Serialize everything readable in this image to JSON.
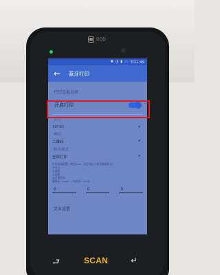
{
  "device": {
    "brand_logo_text": "DDD",
    "bottom_buttons": {
      "back_glyph": "⮐",
      "scan_label": "SCAN",
      "enter_glyph": "↵"
    }
  },
  "status": {
    "time": "下午1:49"
  },
  "app": {
    "title": "蓝牙打印",
    "back_icon": "arrow-left-icon"
  },
  "settings": {
    "printer_section": "打印设备选择",
    "toggle_label": "开启打印",
    "toggle_on": true,
    "size": {
      "label": "尺寸",
      "value": "30*30"
    },
    "template": {
      "label": "模板",
      "value": "二维码"
    },
    "print_mode": {
      "label": "触发模式",
      "value": "全部打印"
    },
    "description_lines": [
      "打印坐标配置（单位mm，以打印左上角为坐标起点）",
      "100 2",
      "左边距",
      "上边距",
      "从左侧开始",
      "横坐标（mm），纵坐标（mm）"
    ],
    "offsets": [
      "0",
      "0",
      "0"
    ],
    "text_settings_label": "文本设置"
  },
  "colors": {
    "appbar": "#3f6bd1",
    "switch": "#2e63e2",
    "highlight": "#e01b22",
    "scan": "#f2b623"
  }
}
